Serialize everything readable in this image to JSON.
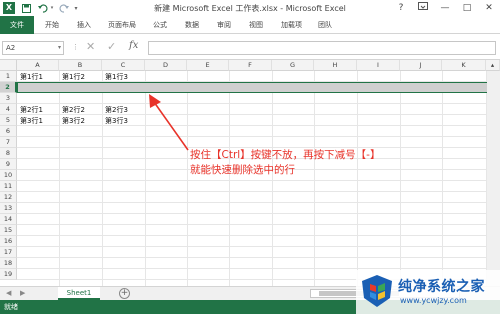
{
  "window": {
    "title": "新建 Microsoft Excel 工作表.xlsx - Microsoft Excel",
    "help": "?",
    "minimize": "—",
    "maximize": "□",
    "close": "✕"
  },
  "quick_access": {
    "logo": "X",
    "save_icon": "save-icon",
    "undo_icon": "undo-icon",
    "redo_icon": "redo-icon"
  },
  "ribbon": {
    "tabs": [
      {
        "label": "文件"
      },
      {
        "label": "开始"
      },
      {
        "label": "插入"
      },
      {
        "label": "页面布局"
      },
      {
        "label": "公式"
      },
      {
        "label": "数据"
      },
      {
        "label": "审阅"
      },
      {
        "label": "视图"
      },
      {
        "label": "加载项"
      },
      {
        "label": "团队"
      }
    ]
  },
  "formula_bar": {
    "name_box": "A2",
    "cancel": "✕",
    "enter": "✓",
    "fx": "fx",
    "value": ""
  },
  "grid": {
    "columns": [
      "A",
      "B",
      "C",
      "D",
      "E",
      "F",
      "G",
      "H",
      "I",
      "J",
      "K"
    ],
    "rows": [
      "1",
      "2",
      "3",
      "4",
      "5",
      "6",
      "7",
      "8",
      "9",
      "10",
      "11",
      "12",
      "13",
      "14",
      "15",
      "16",
      "17",
      "18",
      "19"
    ],
    "selected_row": "2",
    "cells": {
      "A1": "第1行1",
      "B1": "第1行2",
      "C1": "第1行3",
      "A4": "第2行1",
      "B4": "第2行2",
      "C4": "第2行3",
      "A5": "第3行1",
      "B5": "第3行2",
      "C5": "第3行3"
    }
  },
  "annotation": {
    "line1": "按住【Ctrl】按键不放，再按下减号【-】",
    "line2": "就能快速删除选中的行",
    "color": "#e8332a"
  },
  "sheets": {
    "tabs": [
      {
        "label": "Sheet1"
      }
    ],
    "add": "+"
  },
  "status": {
    "text": "就绪"
  },
  "watermark": {
    "title": "纯净系统之家",
    "url": "www.ycwjzy.com"
  },
  "colors": {
    "accent": "#217346",
    "watermark": "#1a5fb4"
  }
}
